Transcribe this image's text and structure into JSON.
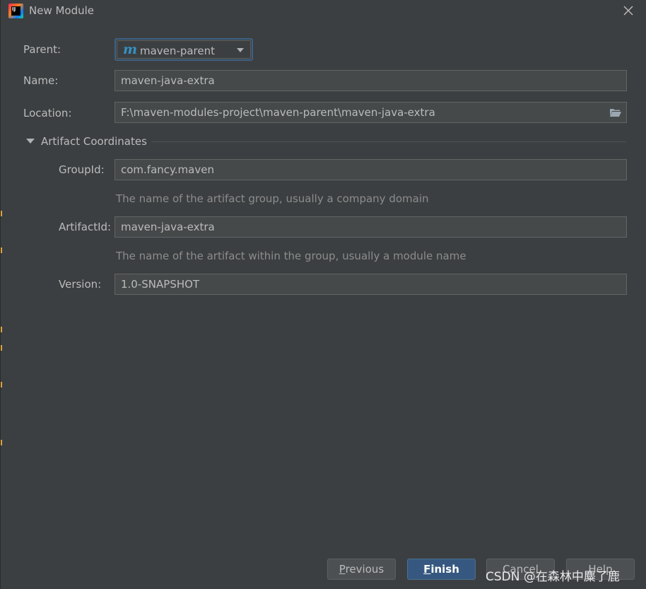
{
  "window": {
    "title": "New Module",
    "app_icon": "intellij-idea-icon",
    "app_icon_text": "IJ",
    "close_icon": "close-icon"
  },
  "form": {
    "parent_label": "Parent:",
    "parent_value": "maven-parent",
    "parent_icon": "maven-m-icon",
    "parent_icon_text": "m",
    "name_label": "Name:",
    "name_value": "maven-java-extra",
    "location_label": "Location:",
    "location_value": "F:\\maven-modules-project\\maven-parent\\maven-java-extra",
    "browse_icon": "folder-icon"
  },
  "artifact": {
    "section_title": "Artifact Coordinates",
    "expanded": true,
    "group_label": "GroupId:",
    "group_value": "com.fancy.maven",
    "group_hint": "The name of the artifact group, usually a company domain",
    "artifact_label": "ArtifactId:",
    "artifact_value": "maven-java-extra",
    "artifact_hint": "The name of the artifact within the group, usually a module name",
    "version_label": "Version:",
    "version_value": "1.0-SNAPSHOT"
  },
  "buttons": {
    "previous_mnemonic": "P",
    "previous_rest": "revious",
    "finish_mnemonic": "F",
    "finish_rest": "inish",
    "cancel_label": "Cancel",
    "help_label": "Help"
  },
  "watermark": "CSDN @在森林中麋了鹿",
  "colors": {
    "background": "#3c3f41",
    "field_background": "#45494a",
    "primary_button": "#365880",
    "focus_border": "#3d6185",
    "maven_icon": "#3592c4"
  }
}
